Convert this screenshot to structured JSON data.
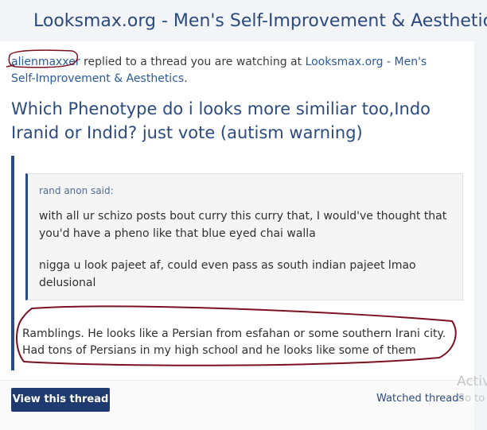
{
  "header": {
    "title": "Looksmax.org - Men's Self-Improvement & Aesthetics"
  },
  "notification": {
    "username": "alienmaxxer",
    "action_text": " replied to a thread you are watching at ",
    "site_link": "Looksmax.org - Men's Self-Improvement & Aesthetics",
    "end_punct": "."
  },
  "thread": {
    "title": "Which Phenotype do i looks more similiar too,Indo Iranid or Indid? just vote (autism warning)"
  },
  "quote": {
    "author": "rand anon said:",
    "paragraphs": [
      "with all ur schizo posts bout curry this curry that, I would've thought that you'd have a pheno like that blue eyed chai walla",
      "nigga u look pajeet af, could even pass as south indian pajeet lmao delusional"
    ]
  },
  "reply": {
    "text": "Ramblings. He looks like a Persian from esfahan or some southern Irani city. Had tons of Persians in my high school and he looks like some of them"
  },
  "footer": {
    "view_button": "View this thread",
    "watched_link": "Watched threads"
  },
  "watermark": {
    "line1": "Activ",
    "line2": "Go to"
  },
  "colors": {
    "accent": "#2b4a80",
    "button_bg": "#1e3a6e",
    "annotation": "#7a1020"
  }
}
